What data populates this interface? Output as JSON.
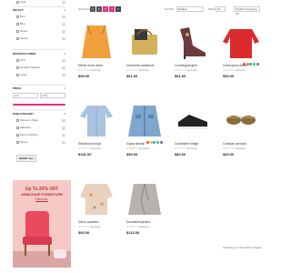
{
  "sidebar": {
    "top_items": [
      {
        "label": "Gold",
        "count": "1"
      }
    ],
    "sections": [
      {
        "title": "SELECT",
        "items": [
          {
            "label": "Red",
            "count": "4"
          },
          {
            "label": "Blue",
            "count": "3"
          },
          {
            "label": "Green",
            "count": "2"
          },
          {
            "label": "Yellow",
            "count": "1"
          }
        ]
      },
      {
        "title": "MANUFACTURER",
        "items": [
          {
            "label": "HTC",
            "count": "1"
          },
          {
            "label": "Hewlett Packard",
            "count": "1"
          },
          {
            "label": "Apple",
            "count": "1"
          }
        ]
      },
      {
        "title": "PRICE",
        "items": []
      },
      {
        "title": "SUBCATEGORY",
        "items": [
          {
            "label": "Women's Wear",
            "count": "3"
          },
          {
            "label": "Watches",
            "count": "2"
          },
          {
            "label": "Men's Clothing",
            "count": "1"
          },
          {
            "label": "Shoes",
            "count": "1"
          }
        ]
      }
    ],
    "price_min": "0 $",
    "price_max": "15 $",
    "reset_label": "RESET ALL",
    "accent": "#e62e83"
  },
  "banner": {
    "discount": "Up To 20% OFF",
    "title": "ARMCHAIR FURNITURE",
    "link": "Discover"
  },
  "toolbar": {
    "view_label": "Grid View",
    "pages": [
      "1",
      "2",
      "3",
      "4",
      "5"
    ],
    "active_page": "3",
    "sort_label": "Sort By",
    "sort_value": "Default",
    "show_label": "Show",
    "show_value": "12",
    "compare_label": "Product Compare (0)"
  },
  "products": [
    {
      "name": "Ethnic Kurta dress",
      "reviews": "0 review(s)",
      "price": "$55.00",
      "image": "top-icon",
      "color": "#f2a03d",
      "rating": 0,
      "swatches": []
    },
    {
      "name": "Geometric sandbook",
      "reviews": "0 review(s)",
      "price": "$61.00",
      "image": "bag-icon",
      "color": "#d4b25c",
      "rating": 0,
      "swatches": []
    },
    {
      "name": "Crossingual gem",
      "reviews": "0 review(s)",
      "price": "$61.00",
      "image": "heel-icon",
      "color": "#6b3a3a",
      "rating": 0,
      "swatches": []
    },
    {
      "name": "Crews pirou dress",
      "reviews": "0 review(s)",
      "price": "$90.00",
      "image": "sweater-icon",
      "color": "#d92b2b",
      "rating": 0,
      "swatches": [
        "#e74c3c",
        "#e67e22",
        "#3498db",
        "#2ecc71",
        "#9b59b6"
      ]
    },
    {
      "name": "Deluxbook burgit",
      "reviews": "0 review(s)",
      "price": "$181.00",
      "image": "shirt-icon",
      "color": "#a9c4e3",
      "rating": 0,
      "swatches": []
    },
    {
      "name": "Gupta sirkash",
      "reviews": "4 review(s)",
      "price": "$55.00",
      "image": "jacket-icon",
      "color": "#7fa6cf",
      "rating": 4,
      "swatches": [
        "#e74c3c",
        "#f1c40f",
        "#3498db",
        "#2ecc71",
        "#9b59b6"
      ],
      "old_price": "$68.00"
    },
    {
      "name": "Cordustrim bridge",
      "reviews": "0 review(s)",
      "price": "$84.00",
      "image": "sneaker-icon",
      "color": "#222222",
      "rating": 0,
      "swatches": []
    },
    {
      "name": "Coralpia carousel",
      "reviews": "0 review(s)",
      "price": "$60.00",
      "image": "sunglasses-icon",
      "color": "#8a6b3b",
      "rating": 0,
      "swatches": []
    },
    {
      "name": "Daron pacificks",
      "reviews": "0 review(s)",
      "price": "$93.00",
      "image": "blouse-icon",
      "color": "#e8d2bf",
      "rating": 0,
      "swatches": []
    },
    {
      "name": "Duomsked jackfor",
      "reviews": "0 review(s)",
      "price": "$113.00",
      "image": "blazer-icon",
      "color": "#b7b1b0",
      "rating": 0,
      "swatches": []
    }
  ],
  "showing": "Showing 1 to 10 of 10 (1 Pages)"
}
